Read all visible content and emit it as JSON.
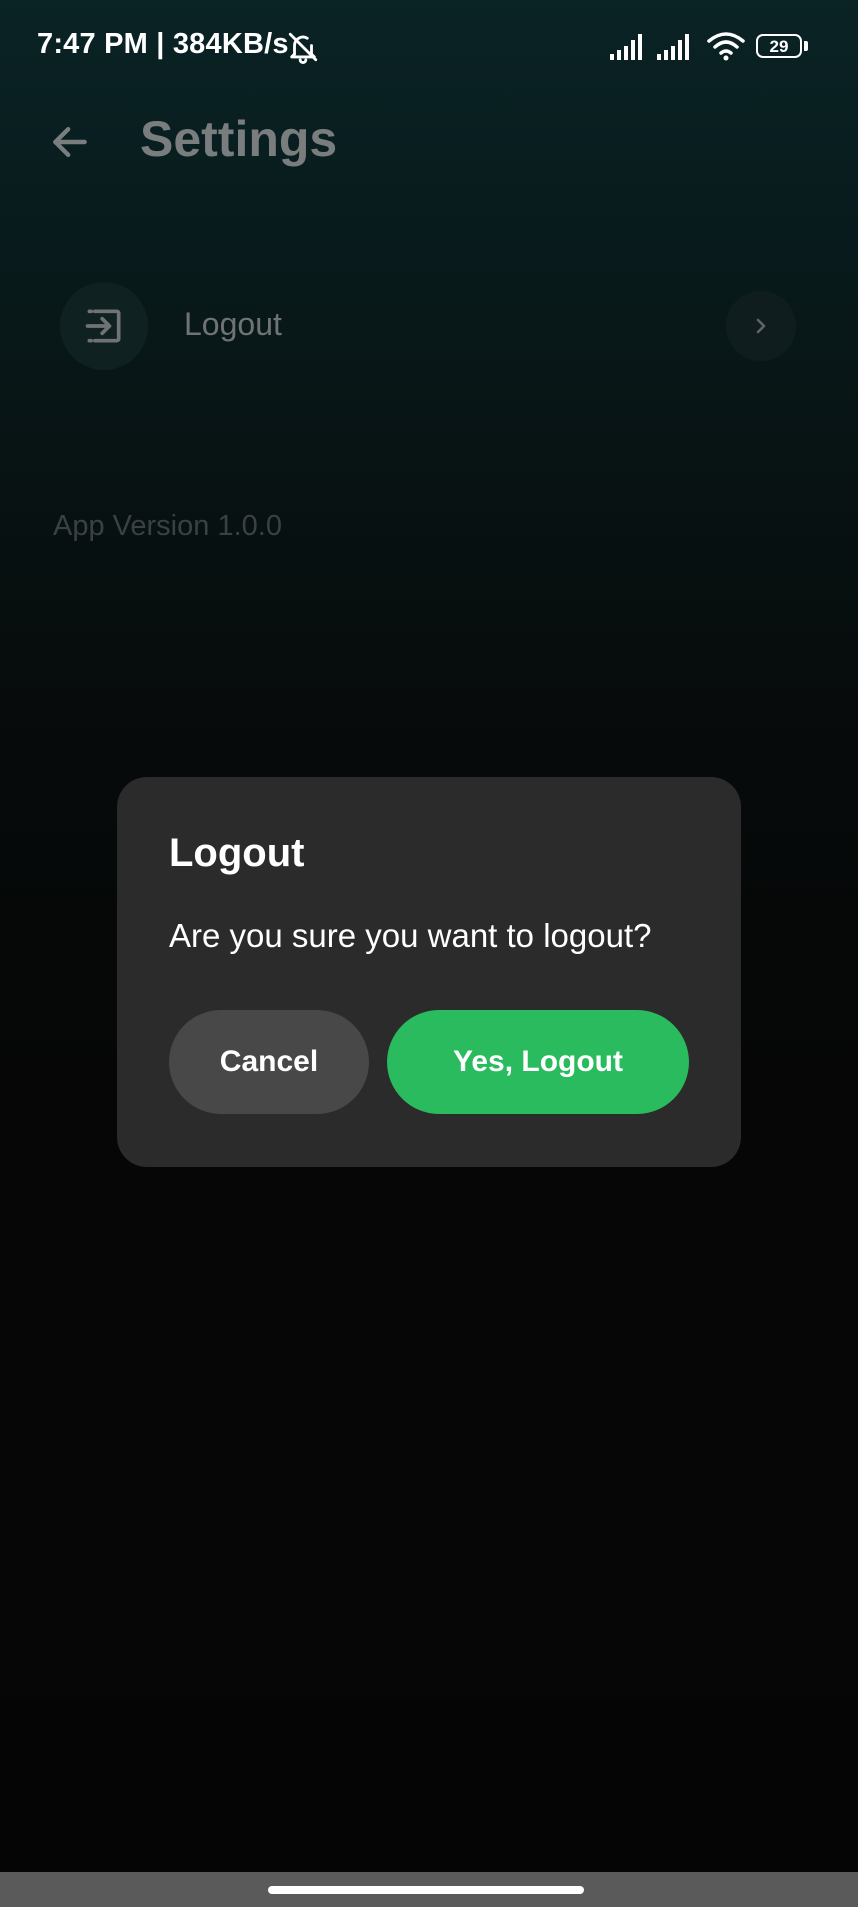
{
  "status_bar": {
    "time": "7:47 PM | 384KB/s",
    "battery": "29"
  },
  "header": {
    "title": "Settings"
  },
  "settings": {
    "logout_label": "Logout",
    "app_version": "App Version 1.0.0"
  },
  "dialog": {
    "title": "Logout",
    "message": "Are you sure you want to logout?",
    "cancel_label": "Cancel",
    "confirm_label": "Yes, Logout"
  },
  "colors": {
    "accent": "#29bb5e",
    "dialog_bg": "#2b2b2b",
    "cancel_bg": "#484848"
  }
}
